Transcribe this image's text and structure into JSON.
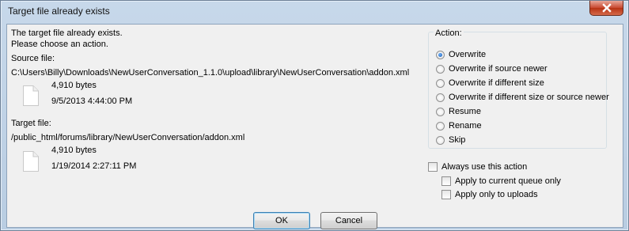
{
  "window": {
    "title": "Target file already exists"
  },
  "message": {
    "line1": "The target file already exists.",
    "line2": "Please choose an action."
  },
  "source": {
    "label": "Source file:",
    "path": "C:\\Users\\Billy\\Downloads\\NewUserConversation_1.1.0\\upload\\library\\NewUserConversation\\addon.xml",
    "size": "4,910 bytes",
    "date": "9/5/2013 4:44:00 PM",
    "icon": "file-icon"
  },
  "target": {
    "label": "Target file:",
    "path": "/public_html/forums/library/NewUserConversation/addon.xml",
    "size": "4,910 bytes",
    "date": "1/19/2014 2:27:11 PM",
    "icon": "file-icon"
  },
  "action": {
    "legend": "Action:",
    "selected": "Overwrite",
    "options": [
      "Overwrite",
      "Overwrite if source newer",
      "Overwrite if different size",
      "Overwrite if different size or source newer",
      "Resume",
      "Rename",
      "Skip"
    ]
  },
  "options": {
    "always_use": {
      "label": "Always use this action",
      "checked": false
    },
    "current_queue": {
      "label": "Apply to current queue only",
      "checked": false
    },
    "uploads_only": {
      "label": "Apply only to uploads",
      "checked": false
    }
  },
  "buttons": {
    "ok": "OK",
    "cancel": "Cancel"
  },
  "colors": {
    "titlebar": "#c7d8ea",
    "close": "#c8482f",
    "dialog_bg": "#f0f0f0"
  }
}
